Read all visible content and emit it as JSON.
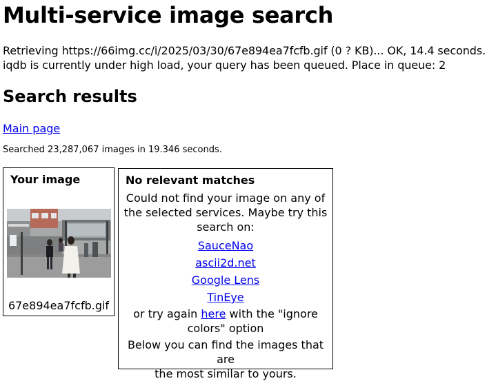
{
  "header": {
    "title": "Multi-service image search"
  },
  "status": {
    "retrieving": "Retrieving https://66img.cc/i/2025/03/30/67e894ea7fcfb.gif (0 ? KB)... OK, 14.4 seconds.",
    "queue": "iqdb is currently under high load, your query has been queued. Place in queue: 2"
  },
  "results": {
    "heading": "Search results",
    "main_page_link": "Main page",
    "searched": "Searched 23,287,067 images in 19.346 seconds."
  },
  "your_image": {
    "heading": "Your image",
    "filename": "67e894ea7fcfb.gif"
  },
  "no_match": {
    "heading": "No relevant matches",
    "message_lines": [
      "Could not find your image on any of",
      "the selected services. Maybe try this",
      "search on:"
    ],
    "services": [
      "SauceNao",
      "ascii2d.net",
      "Google Lens",
      "TinEye"
    ],
    "retry_prefix": "or try again ",
    "retry_link": "here",
    "retry_suffix": " with the \"ignore",
    "retry_suffix2": "colors\" option",
    "below_lines": [
      "Below you can find the images that are",
      "the most similar to yours."
    ]
  },
  "colors": {
    "link": "#0000ee",
    "text": "#000000",
    "border": "#000000"
  }
}
